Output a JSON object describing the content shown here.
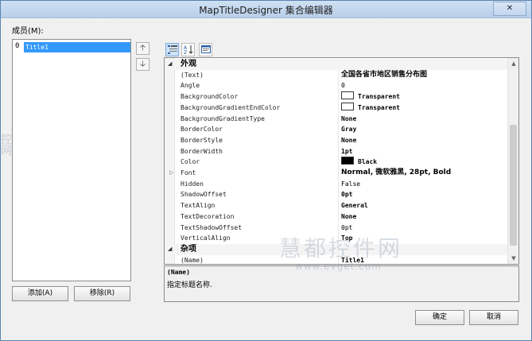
{
  "window": {
    "title": "MapTitleDesigner 集合编辑器",
    "close_glyph": "✕"
  },
  "members": {
    "label": "成员(M):",
    "items": [
      {
        "index": "0",
        "name": "Title1"
      }
    ],
    "move_up_glyph": "🡡",
    "move_down_glyph": "🡣",
    "add_button": "添加(A)",
    "remove_button": "移除(R)"
  },
  "toolbar": {
    "categorized_icon": "categorized-icon",
    "alphabetical_icon": "alphabetical-icon",
    "property_pages_icon": "property-pages-icon"
  },
  "properties": {
    "appearance_category": "外观",
    "misc_category": "杂项",
    "appearance": [
      {
        "name": "(Text)",
        "value": "全国各省市地区销售分布图"
      },
      {
        "name": "Angle",
        "value": "0"
      },
      {
        "name": "BackgroundColor",
        "value": "Transparent",
        "swatch": "#ffffff"
      },
      {
        "name": "BackgroundGradientEndColor",
        "value": "Transparent",
        "swatch": "#ffffff"
      },
      {
        "name": "BackgroundGradientType",
        "value": "None"
      },
      {
        "name": "BorderColor",
        "value": "Gray"
      },
      {
        "name": "BorderStyle",
        "value": "None"
      },
      {
        "name": "BorderWidth",
        "value": "1pt"
      },
      {
        "name": "Color",
        "value": "Black",
        "swatch": "#000000"
      },
      {
        "name": "Font",
        "value": "Normal, 微软雅黑, 28pt, Bold"
      },
      {
        "name": "Hidden",
        "value": "False"
      },
      {
        "name": "ShadowOffset",
        "value": "0pt"
      },
      {
        "name": "TextAlign",
        "value": "General"
      },
      {
        "name": "TextDecoration",
        "value": "None"
      },
      {
        "name": "TextShadowOffset",
        "value": "0pt"
      },
      {
        "name": "VerticalAlign",
        "value": "Top"
      }
    ],
    "misc": [
      {
        "name": "(Name)",
        "value": "Title1"
      }
    ]
  },
  "description": {
    "title": "(Name)",
    "text": "指定标题名称."
  },
  "footer": {
    "ok_button": "确定",
    "cancel_button": "取消"
  },
  "watermark": {
    "text": "慧都控件网",
    "url": "www.evget.com",
    "left_text": "控\n网"
  }
}
